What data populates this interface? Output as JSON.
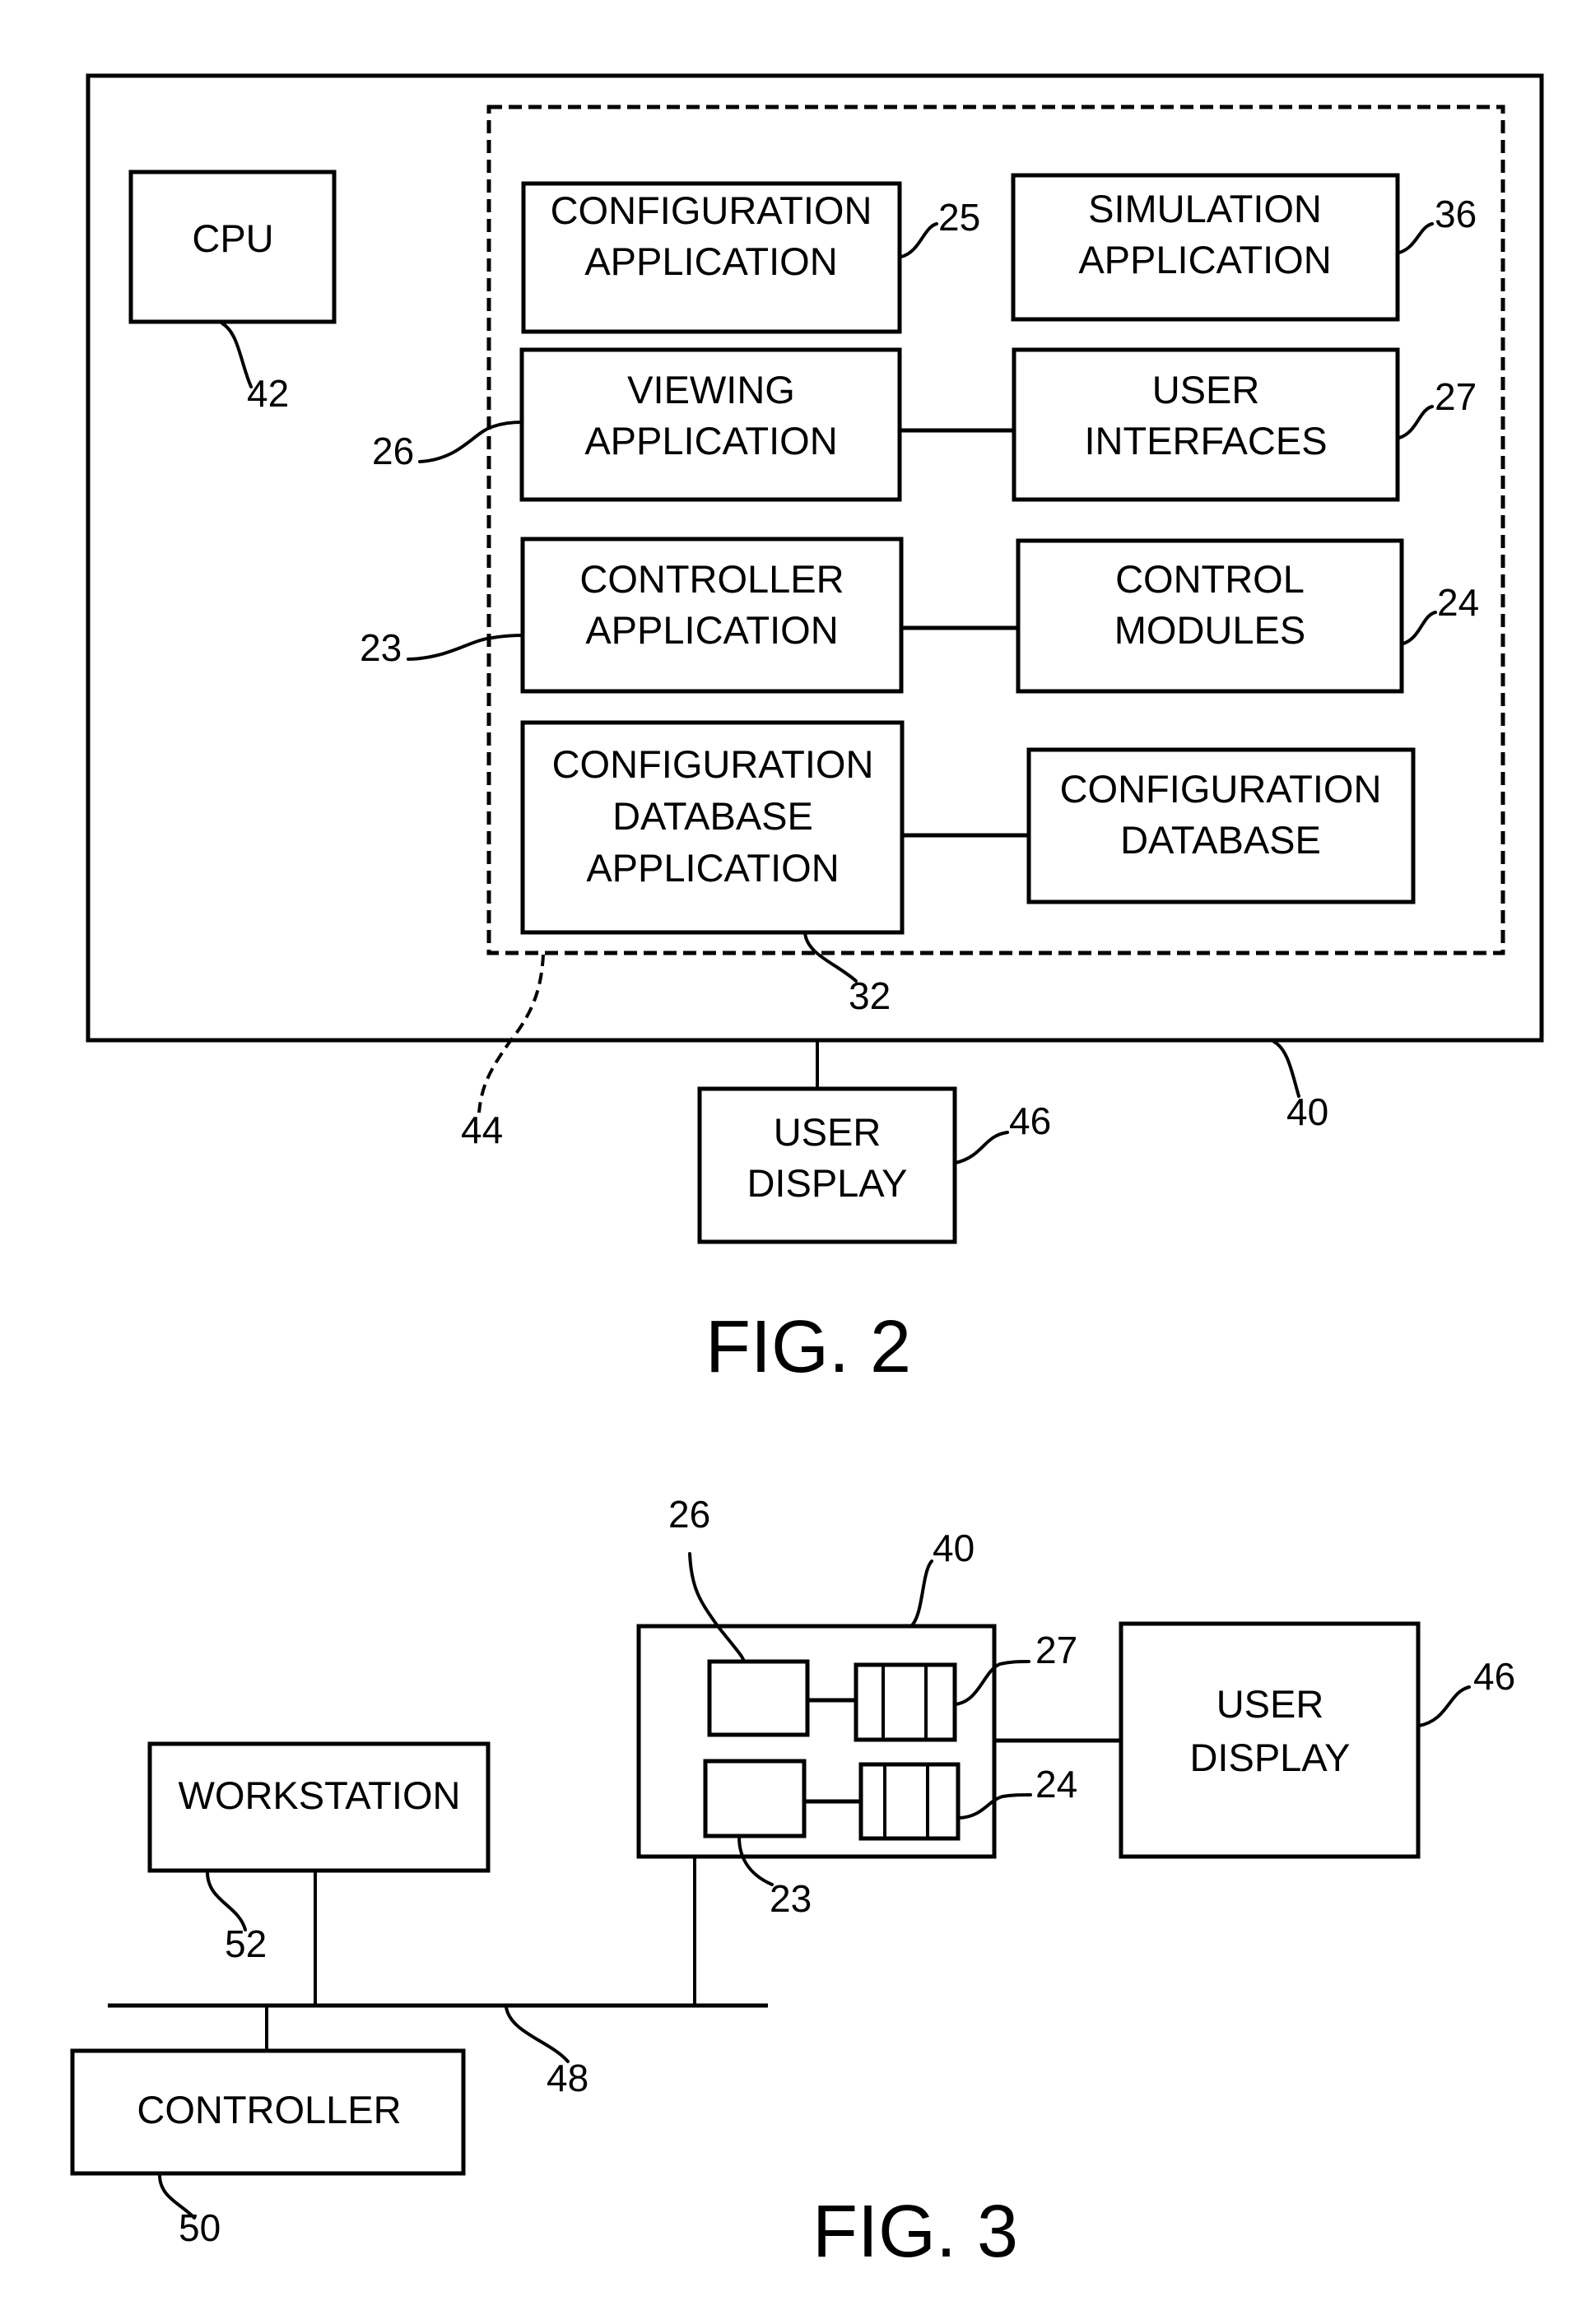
{
  "fig2": {
    "caption": "FIG. 2",
    "refs": {
      "computer": "40",
      "cpu": "42",
      "memory": "44",
      "config_app": "25",
      "simulation_app": "36",
      "viewing_app": "26",
      "user_interfaces": "27",
      "controller_app": "23",
      "control_modules": "24",
      "config_db_app": "32",
      "user_display": "46"
    },
    "blocks": {
      "cpu": [
        "CPU"
      ],
      "config_app": [
        "CONFIGURATION",
        "APPLICATION"
      ],
      "simulation_app": [
        "SIMULATION",
        "APPLICATION"
      ],
      "viewing_app": [
        "VIEWING",
        "APPLICATION"
      ],
      "user_interfaces": [
        "USER",
        "INTERFACES"
      ],
      "controller_app": [
        "CONTROLLER",
        "APPLICATION"
      ],
      "control_modules": [
        "CONTROL",
        "MODULES"
      ],
      "config_db_app": [
        "CONFIGURATION",
        "DATABASE",
        "APPLICATION"
      ],
      "config_db": [
        "CONFIGURATION",
        "DATABASE"
      ],
      "user_display": [
        "USER",
        "DISPLAY"
      ]
    }
  },
  "fig3": {
    "caption": "FIG. 3",
    "refs": {
      "viewing_app": "26",
      "computer": "40",
      "user_interfaces": "27",
      "control_modules": "24",
      "controller_app": "23",
      "user_display": "46",
      "workstation": "52",
      "bus": "48",
      "controller": "50"
    },
    "blocks": {
      "user_display": [
        "USER",
        "DISPLAY"
      ],
      "workstation": [
        "WORKSTATION"
      ],
      "controller": [
        "CONTROLLER"
      ]
    }
  }
}
